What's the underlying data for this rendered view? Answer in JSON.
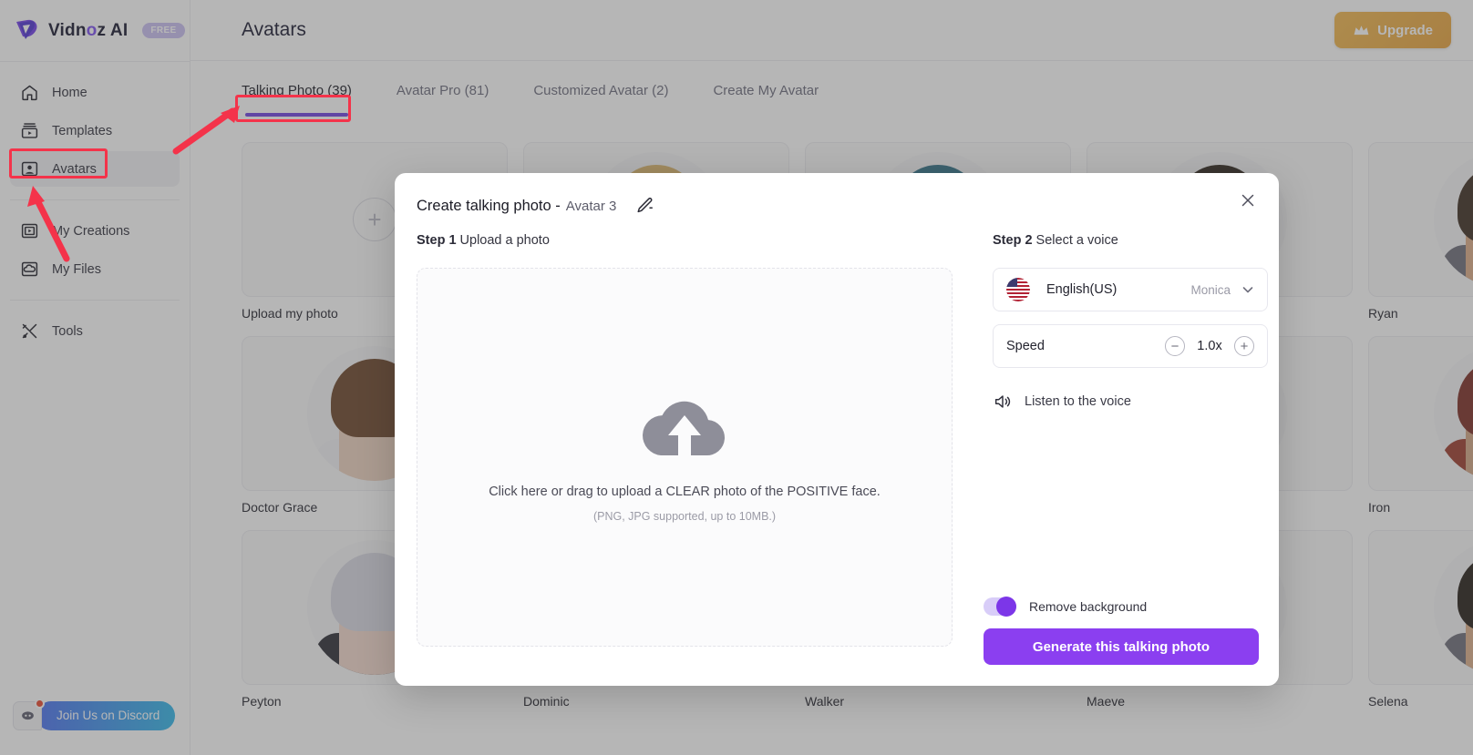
{
  "app": {
    "brand_name_1": "Vidn",
    "brand_name_dot": "o",
    "brand_name_2": "z AI",
    "plan_badge": "FREE"
  },
  "sidebar": {
    "items": [
      {
        "label": "Home",
        "icon": "home-icon",
        "active": false
      },
      {
        "label": "Templates",
        "icon": "templates-icon",
        "active": false
      },
      {
        "label": "Avatars",
        "icon": "avatars-icon",
        "active": true
      },
      {
        "label": "My Creations",
        "icon": "my-creations-icon",
        "active": false
      },
      {
        "label": "My Files",
        "icon": "my-files-icon",
        "active": false
      },
      {
        "label": "Tools",
        "icon": "tools-icon",
        "active": false
      }
    ],
    "discord_label": "Join Us on Discord"
  },
  "header": {
    "title": "Avatars",
    "upgrade_label": "Upgrade"
  },
  "tabs": [
    {
      "label": "Talking Photo (39)",
      "active": true
    },
    {
      "label": "Avatar Pro (81)",
      "active": false
    },
    {
      "label": "Customized Avatar (2)",
      "active": false
    },
    {
      "label": "Create My Avatar",
      "active": false
    }
  ],
  "grid": {
    "cards": [
      {
        "label": "Upload my photo",
        "kind": "upload"
      },
      {
        "label": "",
        "kind": "face",
        "hair": "#d9b36a",
        "skin": "#e8c0a0",
        "shirt": "#caa869"
      },
      {
        "label": "",
        "kind": "face",
        "hair": "#2e6f86",
        "skin": "#e6c3aa",
        "shirt": "#4a8aa0"
      },
      {
        "label": "",
        "kind": "face",
        "hair": "#2a2119",
        "skin": "#c98f6a",
        "shirt": "#3a3a44"
      },
      {
        "label": "Ryan",
        "kind": "face",
        "hair": "#3a2a1e",
        "skin": "#dcab86",
        "shirt": "#6b6b78"
      },
      {
        "label": "Doctor Grace",
        "kind": "face",
        "hair": "#6a4326",
        "skin": "#ecd0bd",
        "shirt": "#f2f2f4"
      },
      {
        "label": "",
        "kind": "face",
        "hair": "#1f1a16",
        "skin": "#d6a984",
        "shirt": "#5b5b67"
      },
      {
        "label": "",
        "kind": "face",
        "hair": "#2b2b33",
        "skin": "#e0b696",
        "shirt": "#7a7a86"
      },
      {
        "label": "",
        "kind": "face",
        "hair": "#b0452f",
        "skin": "#eac3a8",
        "shirt": "#8b5a4a"
      },
      {
        "label": "Iron",
        "kind": "face",
        "hair": "#7a2a22",
        "skin": "#d3a583",
        "shirt": "#9b3a2a"
      },
      {
        "label": "Peyton",
        "kind": "face",
        "hair": "#d8d8e2",
        "skin": "#f3d8cb",
        "shirt": "#2a2a33"
      },
      {
        "label": "Dominic",
        "kind": "face",
        "hair": "#241c16",
        "skin": "#d9a983",
        "shirt": "#4b4b57"
      },
      {
        "label": "Walker",
        "kind": "face",
        "hair": "#3b2a1d",
        "skin": "#e3b694",
        "shirt": "#5e5e6a"
      },
      {
        "label": "Maeve",
        "kind": "face",
        "hair": "#4a3020",
        "skin": "#efcdb8",
        "shirt": "#2fc0ad"
      },
      {
        "label": "Selena",
        "kind": "face",
        "hair": "#221a14",
        "skin": "#ddaf89",
        "shirt": "#6c6c78"
      }
    ]
  },
  "modal": {
    "title": "Create talking photo -",
    "avatar_name": "Avatar 3",
    "close_icon": "close-icon",
    "edit_icon": "pencil-icon",
    "step1": {
      "prefix": "Step 1",
      "text": "Upload a photo"
    },
    "step2": {
      "prefix": "Step 2",
      "text": "Select a voice"
    },
    "dropzone": {
      "icon": "cloud-upload-icon",
      "main_text": "Click here or drag to upload a CLEAR photo of the POSITIVE face.",
      "sub_text": "(PNG, JPG supported, up to 10MB.)"
    },
    "voice": {
      "flag_icon": "flag-us-icon",
      "language": "English(US)",
      "voice_name": "Monica",
      "chevron_icon": "chevron-down-icon"
    },
    "speed": {
      "label": "Speed",
      "minus_label": "−",
      "value": "1.0x",
      "plus_label": "+"
    },
    "listen": {
      "icon": "speaker-icon",
      "label": "Listen to the voice"
    },
    "remove_background": {
      "label": "Remove background",
      "enabled": true
    },
    "generate_label": "Generate this talking photo"
  },
  "colors": {
    "accent_purple": "#8b3ff0",
    "tab_underline": "#6d3fe0",
    "upgrade_gold": "#e8a23a",
    "annotation_red": "#f4334a",
    "discord_blue": "#2fb6e8"
  }
}
